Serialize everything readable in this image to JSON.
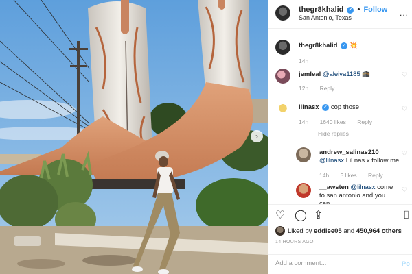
{
  "header": {
    "username": "thegr8khalid",
    "verified_glyph": "✓",
    "separator": "•",
    "follow_label": "Follow",
    "location": "San Antonio, Texas",
    "more_label": "..."
  },
  "comments": [
    {
      "username": "thegr8khalid",
      "verified_glyph": "✓",
      "text": "💥",
      "time": "14h"
    },
    {
      "username": "jemleal",
      "mention": "@aleiva1185",
      "text": "🕋",
      "time": "12h",
      "reply_label": "Reply"
    },
    {
      "username": "lilnasx",
      "verified_glyph": "✓",
      "text": "cop those",
      "time": "14h",
      "likes": "1640 likes",
      "reply_label": "Reply",
      "hide_replies": "Hide replies"
    },
    {
      "username": "andrew_salinas210",
      "mention": "@lilnasx",
      "text": "Lil nas x follow me",
      "time": "14h",
      "likes": "3 likes",
      "reply_label": "Reply"
    },
    {
      "username": "__awsten",
      "mention": "@lilnasx",
      "text": "come to san antonio and you can"
    }
  ],
  "actions": {
    "heart_icon": "♡",
    "comment_icon": "◯",
    "share_icon": "⇪",
    "bookmark_icon": "⌷"
  },
  "likes": {
    "prefix": "Liked by",
    "user": "eddiee05",
    "joiner": "and",
    "count": "450,964 others"
  },
  "timestamp": "14 HOURS AGO",
  "add_comment": {
    "placeholder": "Add a comment...",
    "post_label": "Po"
  },
  "carousel_next": "›"
}
